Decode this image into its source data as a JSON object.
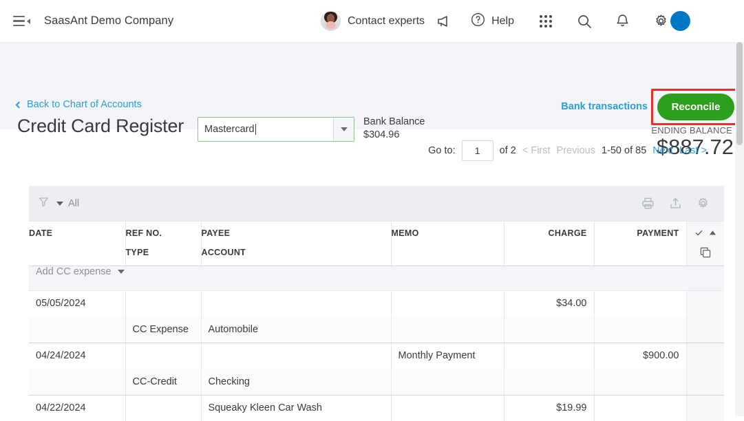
{
  "topnav": {
    "menu_icon": "hamburger-collapse-icon",
    "company_name": "SaasAnt Demo Company",
    "contact_experts_label": "Contact experts",
    "avatar_name": "expert-avatar",
    "megaphone_icon": "megaphone-icon",
    "help_label": "Help",
    "help_icon": "question-circle-icon",
    "apps_icon": "grid-apps-icon",
    "search_icon": "search-icon",
    "notifications_icon": "bell-icon",
    "settings_icon": "gear-icon",
    "user_badge_color": "#0077c5"
  },
  "page_header": {
    "back_link": "Back to Chart of Accounts",
    "title": "Credit Card Register",
    "account_select_value": "Mastercard",
    "account_select_border_color": "#8ac48a",
    "bank_balance_label": "Bank Balance",
    "bank_balance_value": "$304.96",
    "bank_transactions_link": "Bank transactions",
    "reconcile_button": "Reconcile",
    "reconcile_color": "#2ca01c",
    "highlight_color": "#e8312a",
    "ending_balance_label": "ENDING BALANCE",
    "ending_balance_value": "$887.72"
  },
  "pagination": {
    "goto_label": "Go to:",
    "page_value": "1",
    "of_pages": "of 2",
    "first_label": "< First",
    "previous_label": "Previous",
    "range_label": "1-50 of 85",
    "next_label": "Next",
    "last_label": "Last >"
  },
  "toolbar": {
    "filter_icon": "funnel-filter-icon",
    "filter_label": "All",
    "print_icon": "printer-icon",
    "export_icon": "export-upload-icon",
    "settings_icon": "gear-icon"
  },
  "table": {
    "headers": {
      "date": "DATE",
      "ref_no": "REF NO.",
      "type": "TYPE",
      "payee": "PAYEE",
      "account": "ACCOUNT",
      "memo": "MEMO",
      "charge": "CHARGE",
      "payment": "PAYMENT",
      "check_icon": "checkmark-icon",
      "sort_icon": "sort-ascending-icon",
      "copy_icon": "duplicate-columns-icon"
    },
    "add_row_label": "Add CC expense",
    "rows": [
      {
        "date": "05/05/2024",
        "ref_no": "",
        "type": "CC Expense",
        "payee": "",
        "account": "Automobile",
        "memo": "",
        "charge": "$34.00",
        "payment": ""
      },
      {
        "date": "04/24/2024",
        "ref_no": "",
        "type": "CC-Credit",
        "payee": "",
        "account": "Checking",
        "memo": "Monthly Payment",
        "charge": "",
        "payment": "$900.00"
      },
      {
        "date": "04/22/2024",
        "ref_no": "",
        "type": "",
        "payee": "Squeaky Kleen Car Wash",
        "account": "",
        "memo": "",
        "charge": "$19.99",
        "payment": ""
      }
    ]
  }
}
